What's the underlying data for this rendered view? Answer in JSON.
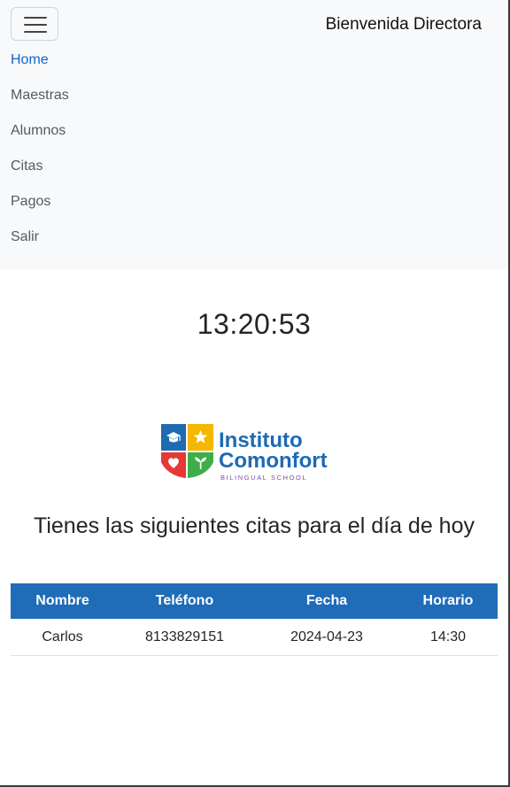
{
  "navbar": {
    "welcome_text": "Bienvenida Directora",
    "toggler_icon": "hamburger-menu-icon",
    "items": [
      {
        "label": "Home",
        "active": true
      },
      {
        "label": "Maestras",
        "active": false
      },
      {
        "label": "Alumnos",
        "active": false
      },
      {
        "label": "Citas",
        "active": false
      },
      {
        "label": "Pagos",
        "active": false
      },
      {
        "label": "Salir",
        "active": false
      }
    ]
  },
  "clock": {
    "time": "13:20:53"
  },
  "logo": {
    "line1": "Instituto",
    "line2": "Comonfort",
    "tagline": "BILINGUAL SCHOOL",
    "colors": {
      "blue": "#1e6ab3",
      "yellow": "#f5b800",
      "red": "#e53935",
      "green": "#3fae49",
      "text": "#1e6ab3",
      "tagline": "#7b4aa0"
    }
  },
  "main": {
    "heading": "Tienes las siguientes citas para el día de hoy"
  },
  "table": {
    "headers": [
      "Nombre",
      "Teléfono",
      "Fecha",
      "Horario"
    ],
    "rows": [
      [
        "Carlos",
        "8133829151",
        "2024-04-23",
        "14:30"
      ]
    ]
  },
  "colors": {
    "navbar_bg": "#f8f9fa",
    "link_active": "#1565c0",
    "table_header_bg": "#1f6cb8"
  }
}
